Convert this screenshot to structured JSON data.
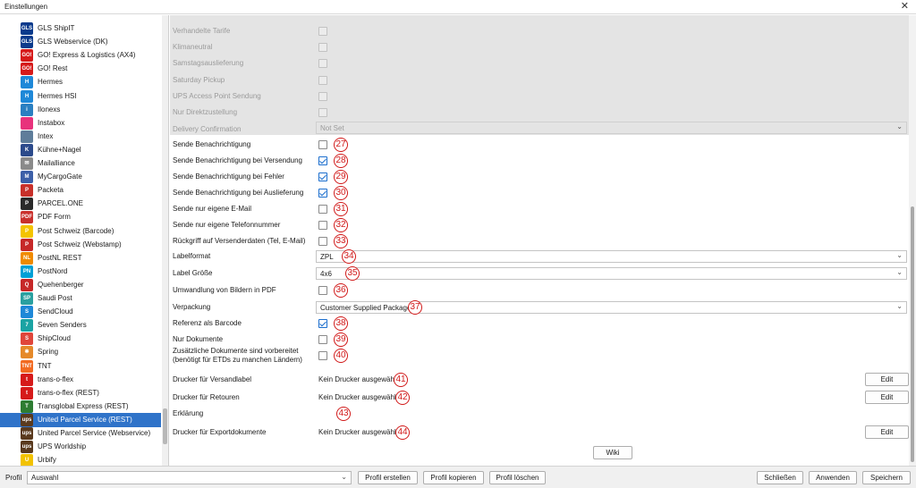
{
  "window": {
    "title": "Einstellungen",
    "close_glyph": "✕"
  },
  "sidebar": {
    "items": [
      {
        "label": "GLS ShipIT",
        "icon": "gls-logo-icon",
        "badge": "GLS",
        "color": "#0a3a8c"
      },
      {
        "label": "GLS Webservice (DK)",
        "icon": "gls-logo-icon",
        "badge": "GLS",
        "color": "#0a3a8c"
      },
      {
        "label": "GO! Express & Logistics (AX4)",
        "icon": "go-logo-icon",
        "badge": "GO!",
        "color": "#d61a1a"
      },
      {
        "label": "GO! Rest",
        "icon": "go-logo-icon",
        "badge": "GO!",
        "color": "#d61a1a"
      },
      {
        "label": "Hermes",
        "icon": "hermes-logo-icon",
        "badge": "H",
        "color": "#1e88d8"
      },
      {
        "label": "Hermes HSI",
        "icon": "hermes-logo-icon",
        "badge": "H",
        "color": "#1e88d8"
      },
      {
        "label": "Ilonexs",
        "icon": "ilonexs-logo-icon",
        "badge": "i",
        "color": "#2a7fc1"
      },
      {
        "label": "Instabox",
        "icon": "instabox-logo-icon",
        "badge": "",
        "color": "#e8327c"
      },
      {
        "label": "Intex",
        "icon": "intex-logo-icon",
        "badge": "",
        "color": "#5e7d9a"
      },
      {
        "label": "Kühne+Nagel",
        "icon": "kuehne-nagel-logo-icon",
        "badge": "K",
        "color": "#2b4a8b"
      },
      {
        "label": "Mailalliance",
        "icon": "mail-icon",
        "badge": "✉",
        "color": "#8a8a8a"
      },
      {
        "label": "MyCargoGate",
        "icon": "mycargogate-logo-icon",
        "badge": "M",
        "color": "#3c5fa8"
      },
      {
        "label": "Packeta",
        "icon": "packeta-logo-icon",
        "badge": "P",
        "color": "#c8302a"
      },
      {
        "label": "PARCEL.ONE",
        "icon": "parcel-one-logo-icon",
        "badge": "P",
        "color": "#2a2a2a"
      },
      {
        "label": "PDF Form",
        "icon": "pdf-icon",
        "badge": "PDF",
        "color": "#c9302c"
      },
      {
        "label": "Post Schweiz (Barcode)",
        "icon": "post-schweiz-logo-icon",
        "badge": "P",
        "color": "#f4c400"
      },
      {
        "label": "Post Schweiz (Webstamp)",
        "icon": "post-schweiz-logo-icon",
        "badge": "P",
        "color": "#c62828"
      },
      {
        "label": "PostNL REST",
        "icon": "postnl-logo-icon",
        "badge": "NL",
        "color": "#f08a00"
      },
      {
        "label": "PostNord",
        "icon": "postnord-logo-icon",
        "badge": "PN",
        "color": "#00a0d6"
      },
      {
        "label": "Quehenberger",
        "icon": "quehenberger-logo-icon",
        "badge": "Q",
        "color": "#c62828"
      },
      {
        "label": "Saudi Post",
        "icon": "saudi-post-logo-icon",
        "badge": "SP",
        "color": "#2aa0a0"
      },
      {
        "label": "SendCloud",
        "icon": "sendcloud-logo-icon",
        "badge": "S",
        "color": "#1e88d8"
      },
      {
        "label": "Seven Senders",
        "icon": "seven-senders-logo-icon",
        "badge": "7",
        "color": "#1aa3a3"
      },
      {
        "label": "ShipCloud",
        "icon": "shipcloud-logo-icon",
        "badge": "S",
        "color": "#e0463a"
      },
      {
        "label": "Spring",
        "icon": "spring-logo-icon",
        "badge": "✱",
        "color": "#e5892a"
      },
      {
        "label": "TNT",
        "icon": "tnt-logo-icon",
        "badge": "TNT",
        "color": "#f26a21"
      },
      {
        "label": "trans-o-flex",
        "icon": "trans-o-flex-logo-icon",
        "badge": "t",
        "color": "#d61a1a"
      },
      {
        "label": "trans-o-flex (REST)",
        "icon": "trans-o-flex-logo-icon",
        "badge": "t",
        "color": "#d61a1a"
      },
      {
        "label": "Transglobal Express (REST)",
        "icon": "transglobal-logo-icon",
        "badge": "T",
        "color": "#2e7d32"
      },
      {
        "label": "United Parcel Service (REST)",
        "icon": "ups-logo-icon",
        "badge": "ups",
        "color": "#5a3a1e"
      },
      {
        "label": "United Parcel Service (Webservice)",
        "icon": "ups-logo-icon",
        "badge": "ups",
        "color": "#5a3a1e"
      },
      {
        "label": "UPS Worldship",
        "icon": "ups-logo-icon",
        "badge": "ups",
        "color": "#5a3a1e"
      },
      {
        "label": "Urbify",
        "icon": "urbify-logo-icon",
        "badge": "U",
        "color": "#f2c200"
      }
    ],
    "selected_index": 29
  },
  "form": {
    "disabled_rows": [
      {
        "label": "Verhandelte Tarife"
      },
      {
        "label": "Klimaneutral"
      },
      {
        "label": "Samstagsauslieferung"
      },
      {
        "label": "Saturday Pickup"
      },
      {
        "label": "UPS Access Point Sendung"
      },
      {
        "label": "Nur Direktzustellung"
      }
    ],
    "delivery_confirmation": {
      "label": "Delivery Confirmation",
      "value": "Not Set"
    },
    "rows": [
      {
        "kind": "check",
        "label": "Sende Benachrichtigung",
        "checked": false,
        "num": "27"
      },
      {
        "kind": "check",
        "label": "Sende Benachrichtigung bei Versendung",
        "checked": true,
        "num": "28"
      },
      {
        "kind": "check",
        "label": "Sende Benachrichtigung bei Fehler",
        "checked": true,
        "num": "29"
      },
      {
        "kind": "check",
        "label": "Sende Benachrichtigung bei Auslieferung",
        "checked": true,
        "num": "30"
      },
      {
        "kind": "check",
        "label": "Sende nur eigene E-Mail",
        "checked": false,
        "num": "31"
      },
      {
        "kind": "check",
        "label": "Sende nur eigene Telefonnummer",
        "checked": false,
        "num": "32"
      },
      {
        "kind": "check",
        "label": "Rückgriff auf Versenderdaten (Tel, E-Mail)",
        "checked": false,
        "num": "33"
      },
      {
        "kind": "select",
        "label": "Labelformat",
        "value": "ZPL",
        "num": "34"
      },
      {
        "kind": "select",
        "label": "Label Größe",
        "value": "4x6",
        "num": "35"
      },
      {
        "kind": "check",
        "label": "Umwandlung von Bildern in PDF",
        "checked": false,
        "num": "36"
      },
      {
        "kind": "select",
        "label": "Verpackung",
        "value": "Customer Supplied Package",
        "num": "37"
      },
      {
        "kind": "check",
        "label": "Referenz als Barcode",
        "checked": true,
        "num": "38"
      },
      {
        "kind": "check",
        "label": "Nur Dokumente",
        "checked": false,
        "num": "39"
      },
      {
        "kind": "check2",
        "label": "Zusätzliche Dokumente sind vorbereitet",
        "label2": "(benötigt für ETDs zu manchen Ländern)",
        "checked": false,
        "num": "40"
      },
      {
        "kind": "printer",
        "label": "Drucker für Versandlabel",
        "value": "Kein Drucker ausgewählt",
        "button": "Edit",
        "num": "41"
      },
      {
        "kind": "printer",
        "label": "Drucker für Retouren",
        "value": "Kein Drucker ausgewählt",
        "button": "Edit",
        "num": "42"
      },
      {
        "kind": "text",
        "label": "Erklärung",
        "value": "",
        "num": "43"
      },
      {
        "kind": "printer",
        "label": "Drucker für Exportdokumente",
        "value": "Kein Drucker ausgewählt",
        "button": "Edit",
        "num": "44"
      }
    ],
    "wiki_button": "Wiki"
  },
  "bottom": {
    "profile_label": "Profil",
    "profile_value": "Auswahl",
    "buttons": {
      "create": "Profil erstellen",
      "copy": "Profil kopieren",
      "delete": "Profil löschen",
      "close": "Schließen",
      "apply": "Anwenden",
      "save": "Speichern"
    }
  },
  "icons": {
    "chevron": "⌄",
    "checkmark": "check-icon"
  }
}
